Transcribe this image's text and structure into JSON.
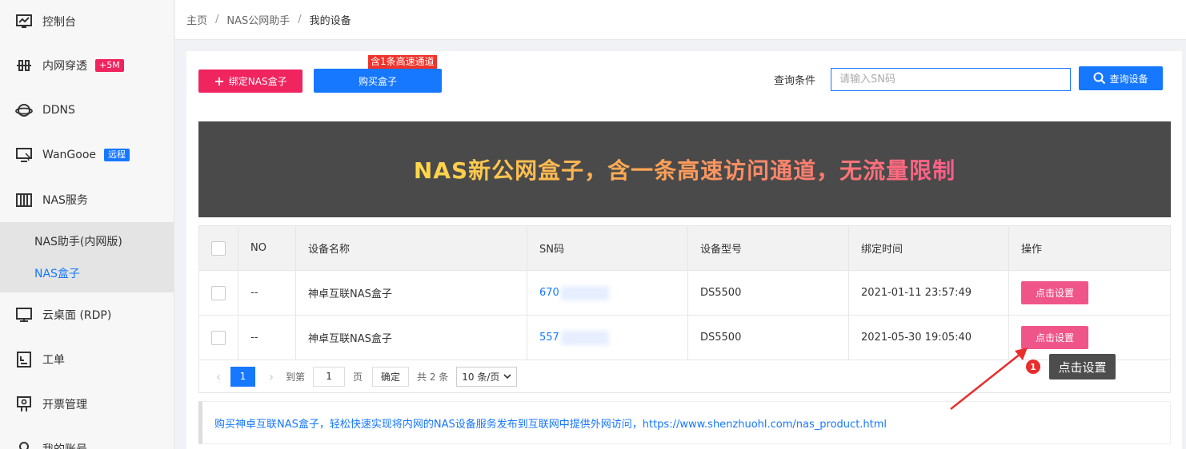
{
  "sidebar": {
    "items": [
      {
        "label": "控制台",
        "icon": "monitor-chart-icon"
      },
      {
        "label": "内网穿透",
        "icon": "network-icon",
        "badge": "+5M",
        "badge_color": "#f0245f"
      },
      {
        "label": "DDNS",
        "icon": "globe-ring-icon"
      },
      {
        "label": "WanGooe",
        "icon": "remote-desktop-icon",
        "badge": "远程",
        "badge_color": "#1677ff"
      },
      {
        "label": "NAS服务",
        "icon": "server-rack-icon"
      },
      {
        "label": "云桌面 (RDP)",
        "icon": "desktop-icon"
      },
      {
        "label": "工单",
        "icon": "ticket-icon"
      },
      {
        "label": "开票管理",
        "icon": "invoice-icon"
      },
      {
        "label": "我的账号",
        "icon": "user-icon"
      }
    ],
    "submenu": [
      {
        "label": "NAS助手(内网版)"
      },
      {
        "label": "NAS盒子",
        "active": true
      }
    ]
  },
  "breadcrumb": {
    "home": "主页",
    "level2": "NAS公网助手",
    "current": "我的设备",
    "sep": "/"
  },
  "toolbar": {
    "bind_label": "绑定NAS盒子",
    "buy_label": "购买盒子",
    "buy_tag": "含1条高速通道",
    "query_label": "查询条件",
    "query_placeholder": "请输入SN码",
    "query_button": "查询设备"
  },
  "banner": {
    "text": "NAS新公网盒子，含一条高速访问通道，无流量限制"
  },
  "table": {
    "columns": [
      "NO",
      "设备名称",
      "SN码",
      "设备型号",
      "绑定时间",
      "操作"
    ],
    "rows": [
      {
        "no": "--",
        "name": "神卓互联NAS盒子",
        "sn": "670",
        "model": "DS5500",
        "time": "2021-01-11 23:57:49",
        "action": "点击设置"
      },
      {
        "no": "--",
        "name": "神卓互联NAS盒子",
        "sn": "557",
        "model": "DS5500",
        "time": "2021-05-30 19:05:40",
        "action": "点击设置"
      }
    ]
  },
  "pager": {
    "current": "1",
    "goto": "到第",
    "page_input": "1",
    "page_unit": "页",
    "confirm": "确定",
    "total": "共 2 条",
    "page_size": "10 条/页"
  },
  "notice": {
    "text": "购买神卓互联NAS盒子，轻松快速实现将内网的NAS设备服务发布到互联网中提供外网访问，https://www.shenzhuohl.com/nas_product.html"
  },
  "tooltip": {
    "step": "1",
    "text": "点击设置"
  },
  "colors": {
    "accent": "#1677ff",
    "pink": "#f0245f",
    "banner_bg": "#4a4a4a"
  }
}
